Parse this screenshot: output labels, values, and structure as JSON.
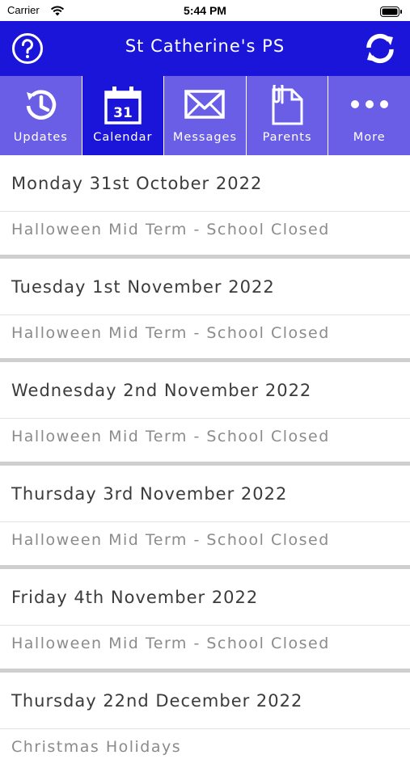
{
  "status_bar": {
    "carrier": "Carrier",
    "time": "5:44 PM"
  },
  "header": {
    "title": "St Catherine's PS",
    "help_icon": "help-icon",
    "refresh_icon": "refresh-icon"
  },
  "tabs": [
    {
      "label": "Updates",
      "icon": "clock-history-icon",
      "active": false
    },
    {
      "label": "Calendar",
      "icon": "calendar-icon",
      "icon_text": "31",
      "active": true
    },
    {
      "label": "Messages",
      "icon": "envelope-icon",
      "active": false
    },
    {
      "label": "Parents",
      "icon": "document-clip-icon",
      "active": false
    },
    {
      "label": "More",
      "icon": "more-dots-icon",
      "active": false
    }
  ],
  "events": [
    {
      "date": "Monday 31st October 2022",
      "title": "Halloween Mid Term - School Closed"
    },
    {
      "date": "Tuesday 1st November 2022",
      "title": "Halloween Mid Term - School Closed"
    },
    {
      "date": "Wednesday 2nd November 2022",
      "title": "Halloween Mid Term - School Closed"
    },
    {
      "date": "Thursday 3rd November 2022",
      "title": "Halloween Mid Term - School Closed"
    },
    {
      "date": "Friday 4th November 2022",
      "title": "Halloween Mid Term - School Closed"
    },
    {
      "date": "Thursday 22nd December 2022",
      "title": "Christmas Holidays"
    }
  ],
  "colors": {
    "header_bg": "#1a15d9",
    "tab_bg": "#6a5ee6",
    "tab_active_bg": "#1a15d9",
    "date_text": "#3b3b3b",
    "title_text": "#8b8b8b"
  }
}
